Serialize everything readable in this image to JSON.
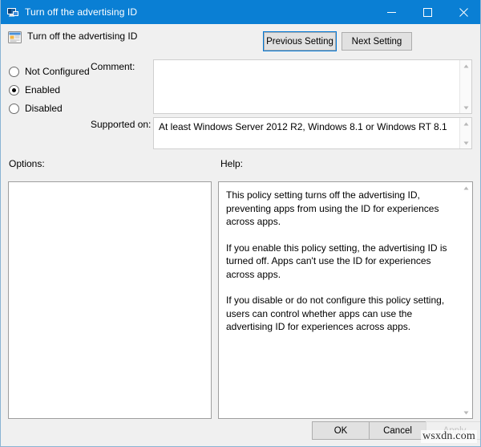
{
  "window": {
    "title": "Turn off the advertising ID",
    "title_icon": "policy-display-icon",
    "accent_color": "#0a7fd4",
    "controls": {
      "minimize": "─",
      "maximize": "□",
      "close": "✕"
    }
  },
  "header": {
    "policy_icon": "group-policy-setting-icon",
    "policy_title": "Turn off the advertising ID",
    "prev_setting_label": "Previous Setting",
    "next_setting_label": "Next Setting"
  },
  "state": {
    "selected": "Enabled",
    "options": [
      {
        "label": "Not Configured",
        "checked": false
      },
      {
        "label": "Enabled",
        "checked": true
      },
      {
        "label": "Disabled",
        "checked": false
      }
    ]
  },
  "fields": {
    "comment_label": "Comment:",
    "comment_value": "",
    "supported_label": "Supported on:",
    "supported_value": "At least Windows Server 2012 R2, Windows 8.1 or Windows RT 8.1"
  },
  "sections": {
    "options_label": "Options:",
    "help_label": "Help:"
  },
  "help": {
    "paragraph1": "This policy setting turns off the advertising ID, preventing apps from using the ID for experiences across apps.",
    "paragraph2": "If you enable this policy setting, the advertising ID is turned off. Apps can't use the ID for experiences across apps.",
    "paragraph3": "If you disable or do not configure this policy setting, users can control whether apps can use the advertising ID for experiences across apps."
  },
  "scrollbar": {
    "up_arrow": "▲",
    "down_arrow": "▼"
  },
  "footer": {
    "ok_label": "OK",
    "cancel_label": "Cancel",
    "apply_label": "Apply",
    "apply_enabled": false
  },
  "watermark": "wsxdn.com"
}
